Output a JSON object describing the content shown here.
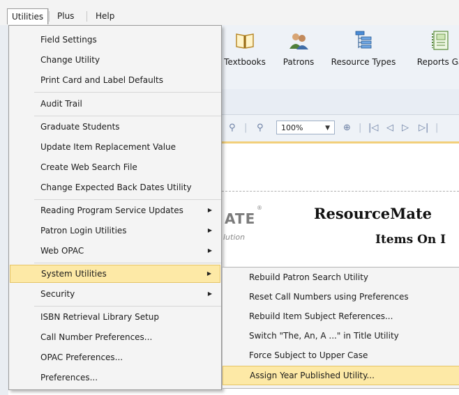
{
  "menubar": {
    "items": [
      {
        "label": "Utilities"
      },
      {
        "label": "Plus"
      },
      {
        "label": "Help"
      }
    ]
  },
  "ribbon": {
    "buttons": [
      {
        "label": "Textbooks",
        "icon": "book-icon"
      },
      {
        "label": "Patrons",
        "icon": "people-icon"
      },
      {
        "label": "Resource Types",
        "icon": "hierarchy-icon"
      },
      {
        "label": "Reports Ga",
        "icon": "report-icon"
      }
    ]
  },
  "viewer_toolbar": {
    "zoom_value": "100%"
  },
  "report": {
    "logo_text": "ATE",
    "logo_tagline": "lution",
    "title": "ResourceMate",
    "subtitle": "Items On I"
  },
  "utilities_menu": {
    "items": [
      {
        "label": "Field Settings"
      },
      {
        "label": "Change Utility"
      },
      {
        "label": "Print Card and Label Defaults"
      },
      {
        "label": "Audit Trail"
      },
      {
        "label": "Graduate Students"
      },
      {
        "label": "Update Item Replacement Value"
      },
      {
        "label": "Create Web Search File"
      },
      {
        "label": "Change Expected Back Dates Utility"
      },
      {
        "label": "Reading Program Service Updates"
      },
      {
        "label": "Patron Login Utilities"
      },
      {
        "label": "Web OPAC"
      },
      {
        "label": "System Utilities"
      },
      {
        "label": "Security"
      },
      {
        "label": "ISBN Retrieval Library Setup"
      },
      {
        "label": "Call Number Preferences..."
      },
      {
        "label": "OPAC Preferences..."
      },
      {
        "label": "Preferences..."
      }
    ]
  },
  "system_utilities_submenu": {
    "items": [
      {
        "label": "Rebuild Patron Search Utility"
      },
      {
        "label": "Reset Call Numbers using Preferences"
      },
      {
        "label": "Rebuild Item Subject References..."
      },
      {
        "label": "Switch \"The, An, A ...\" in Title Utility"
      },
      {
        "label": "Force Subject to Upper Case"
      },
      {
        "label": "Assign Year Published Utility..."
      }
    ]
  },
  "colors": {
    "highlight": "#fde9a6",
    "highlight_border": "#e5c365",
    "menu_bg": "#f4f4f4"
  }
}
